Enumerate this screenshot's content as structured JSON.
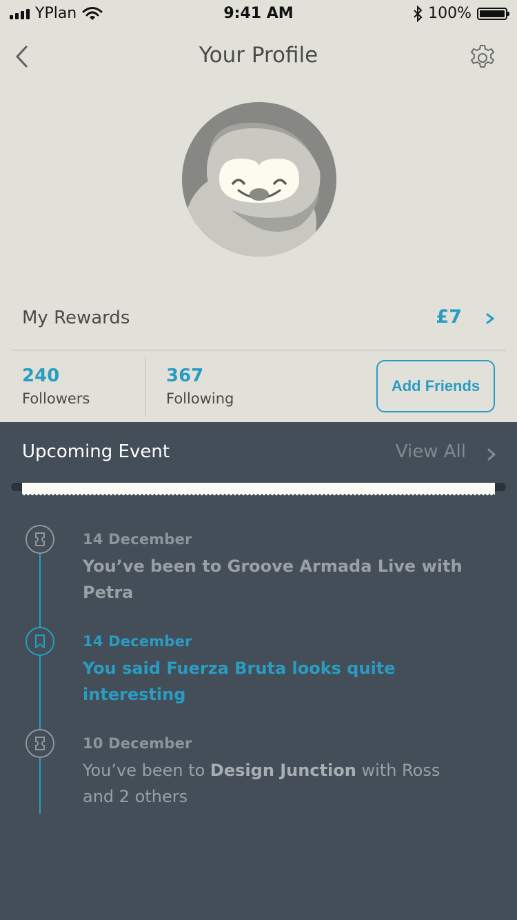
{
  "status_bar": {
    "carrier": "YPlan",
    "time": "9:41 AM",
    "battery": "100%"
  },
  "header": {
    "title": "Your Profile",
    "back_icon": "chevron-left-icon",
    "settings_icon": "gear-icon"
  },
  "profile": {
    "avatar_icon": "sloth-avatar"
  },
  "rewards": {
    "label": "My Rewards",
    "value": "£7"
  },
  "stats": {
    "followers_count": "240",
    "followers_label": "Followers",
    "following_count": "367",
    "following_label": "Following",
    "add_friends_label": "Add Friends"
  },
  "upcoming": {
    "title": "Upcoming Event",
    "view_all_label": "View All"
  },
  "timeline": [
    {
      "date": "14 December",
      "text": "You’ve been to Groove Armada Live with Petra"
    },
    {
      "date": "14 December",
      "text": "You said Fuerza Bruta looks quite interesting"
    },
    {
      "date": "10 December",
      "text_prefix": "You’ve been to ",
      "text_bold": "Design Junction",
      "text_suffix": " with Ross and 2 others"
    }
  ],
  "colors": {
    "accent": "#2a9cc2",
    "top_background": "#e2e1d9",
    "bottom_background": "#434e58"
  }
}
